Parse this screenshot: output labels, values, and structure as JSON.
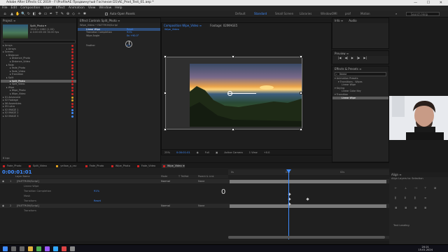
{
  "window": {
    "title": "Adobe After Effects CC 2019 - F:\\ProfileAE Продвинутый Гостиная D1\\AE_Prod_Test_01.aep *",
    "controls": [
      "—",
      "☐",
      "✕"
    ]
  },
  "menu": [
    "File",
    "Edit",
    "Composition",
    "Layer",
    "Effect",
    "Animation",
    "View",
    "Window",
    "Help"
  ],
  "toolbar": {
    "auto_open": "Auto-Open Panels",
    "workspaces": [
      "Default",
      "Standard",
      "Small Screen",
      "Libraries",
      "WindowOMI",
      "prof",
      "Motion"
    ],
    "active_workspace": "Standard",
    "search_placeholder": "Search Help"
  },
  "project_panel": {
    "header": "Project ≡",
    "thumb_name": "Split_Photo ▾",
    "thumb_info": [
      "1920 x 1080 (1.00)",
      "Δ 0:00:05:00 30.00 fps"
    ],
    "tree": [
      {
        "label": "Arrays",
        "indent": 0,
        "color": "#c22"
      },
      {
        "label": "Arrays",
        "indent": 1,
        "color": "#c22"
      },
      {
        "label": "Scenes",
        "indent": 0,
        "color": "#c22"
      },
      {
        "label": "Distance",
        "indent": 1,
        "color": "#c22"
      },
      {
        "label": "Distance_Photo",
        "indent": 2,
        "color": "#c22"
      },
      {
        "label": "Distance_Video",
        "indent": 2,
        "color": "#c22"
      },
      {
        "label": "Fade",
        "indent": 1,
        "color": "#c22"
      },
      {
        "label": "Fade_Photo",
        "indent": 2,
        "color": "#c22"
      },
      {
        "label": "Fade_Video",
        "indent": 2,
        "color": "#c22"
      },
      {
        "label": "Transition",
        "indent": 2,
        "color": "#c22"
      },
      {
        "label": "Split",
        "indent": 1,
        "color": "#c22"
      },
      {
        "label": "Split_Photo",
        "indent": 2,
        "color": "#c22",
        "selected": true
      },
      {
        "label": "Split_Video",
        "indent": 2,
        "color": "#c22"
      },
      {
        "label": "Wipe",
        "indent": 1,
        "color": "#c22"
      },
      {
        "label": "Wipe_Photo",
        "indent": 2,
        "color": "#c22"
      },
      {
        "label": "Wipe_Video",
        "indent": 2,
        "color": "#c22"
      },
      {
        "label": "01 Advanced",
        "indent": 0,
        "color": "#e0a020"
      },
      {
        "label": "02 Footage",
        "indent": 0,
        "color": "#e0a020"
      },
      {
        "label": "06 Assembles",
        "indent": 0,
        "color": "#c22"
      },
      {
        "label": "05 Lutra",
        "indent": 0,
        "color": "#c22"
      },
      {
        "label": "02 IMAGE 1",
        "indent": 0,
        "color": "#3f8cff"
      },
      {
        "label": "02 IMAGE 2",
        "indent": 0,
        "color": "#3f8cff"
      },
      {
        "label": "02 IMAGE 3",
        "indent": 0,
        "color": "#3f8cff"
      }
    ],
    "footer": "8 bpc"
  },
  "effect_controls": {
    "header": "Effect Controls Split_Photo ≡",
    "breadcrumb": "Wipe_Video • FAITTRON/Scripl",
    "rows": [
      {
        "label": "Linear Wipe",
        "value": "Reset",
        "selected": true
      },
      {
        "label": "Transition Completion",
        "value": "91%"
      },
      {
        "label": "Wipe Angle",
        "value": "0x +90.0°"
      },
      {
        "label": "",
        "value": ""
      },
      {
        "label": "",
        "value": ""
      },
      {
        "label": "Feather",
        "value": "0.0"
      }
    ]
  },
  "composition_panel": {
    "tabs": [
      "Composition Wipe_Video ≡",
      "Footage: 02IMAGE5"
    ],
    "sub_tab": "Wipe_Video",
    "footer": {
      "zoom": "25%",
      "timecode": "0:00:01:01",
      "resolution": "Full",
      "camera": "Active Camera",
      "view": "1 View",
      "offset": "+0.0"
    }
  },
  "info_panel": {
    "tabs": [
      "Info ≡",
      "Audio"
    ]
  },
  "preview_panel": {
    "header": "Preview ≡",
    "controls": [
      "|◀",
      "◀|",
      "▶",
      "|▶",
      "▶|"
    ]
  },
  "effects_presets": {
    "header": "Effects & Presets ≡",
    "search": "linear",
    "items": [
      {
        "label": "▾ Animation Presets",
        "indent": 0
      },
      {
        "label": "▾ Transitions - Wipes",
        "indent": 1
      },
      {
        "label": "Linear Wipe",
        "indent": 2
      },
      {
        "label": "▾ Keying",
        "indent": 0
      },
      {
        "label": "Linear Color Key",
        "indent": 2
      },
      {
        "label": "▾ Transition",
        "indent": 0
      },
      {
        "label": "Linear Wipe",
        "indent": 2,
        "selected": true
      }
    ]
  },
  "timeline": {
    "tabs": [
      {
        "label": "Fade_Photo",
        "color": "#c22"
      },
      {
        "label": "Split_Video",
        "color": "#c22"
      },
      {
        "label": "yellow_p_csc",
        "color": "#e0a020"
      },
      {
        "label": "Fade_Photo",
        "color": "#c22"
      },
      {
        "label": "Wipe_Photo",
        "color": "#c22"
      },
      {
        "label": "Fade_Video",
        "color": "#c22"
      },
      {
        "label": "Wipe_Video ≡",
        "color": "#c22",
        "active": true
      }
    ],
    "timecode": "0:00:01:01",
    "columns": [
      "Layer Name",
      "Mode",
      "T TrkMat",
      "Parent & Link"
    ],
    "layers": [
      {
        "num": "1",
        "name": "[FAITTRON/Scripl]",
        "mode": "Normal",
        "parent": "None"
      },
      {
        "num": "",
        "name": "Linear Wipe",
        "mode": "",
        "parent": ""
      },
      {
        "num": "",
        "name": "Transition Completion",
        "mode": "91%",
        "parent": ""
      },
      {
        "num": "",
        "name": "Mask",
        "mode": "",
        "parent": ""
      },
      {
        "num": "",
        "name": "Transform",
        "mode": "Reset",
        "parent": ""
      },
      {
        "num": "2",
        "name": "[FAITTRON/Scripl]",
        "mode": "Normal",
        "parent": "None"
      },
      {
        "num": "",
        "name": "Transform",
        "mode": "",
        "parent": ""
      }
    ],
    "big_number": "0",
    "ruler": [
      "0s",
      "01s",
      "02s"
    ]
  },
  "align_panel": {
    "header": "Align ≡",
    "align_to": "Align Layers to: Selection",
    "text_leading": "Text Leading"
  },
  "taskbar": {
    "time": "20:21",
    "date": "15.01.2024",
    "apps": [
      {
        "name": "windows-icon",
        "color": "#3f8cff"
      },
      {
        "name": "search-icon",
        "color": "#666"
      },
      {
        "name": "taskview-icon",
        "color": "#666"
      },
      {
        "name": "explorer-icon",
        "color": "#e0b040"
      },
      {
        "name": "chrome-icon",
        "color": "#4caf50"
      },
      {
        "name": "ae-icon",
        "color": "#9b59ff"
      },
      {
        "name": "ps-icon",
        "color": "#31a8ff"
      },
      {
        "name": "app-icon",
        "color": "#d44"
      },
      {
        "name": "app-icon-2",
        "color": "#888"
      }
    ]
  }
}
